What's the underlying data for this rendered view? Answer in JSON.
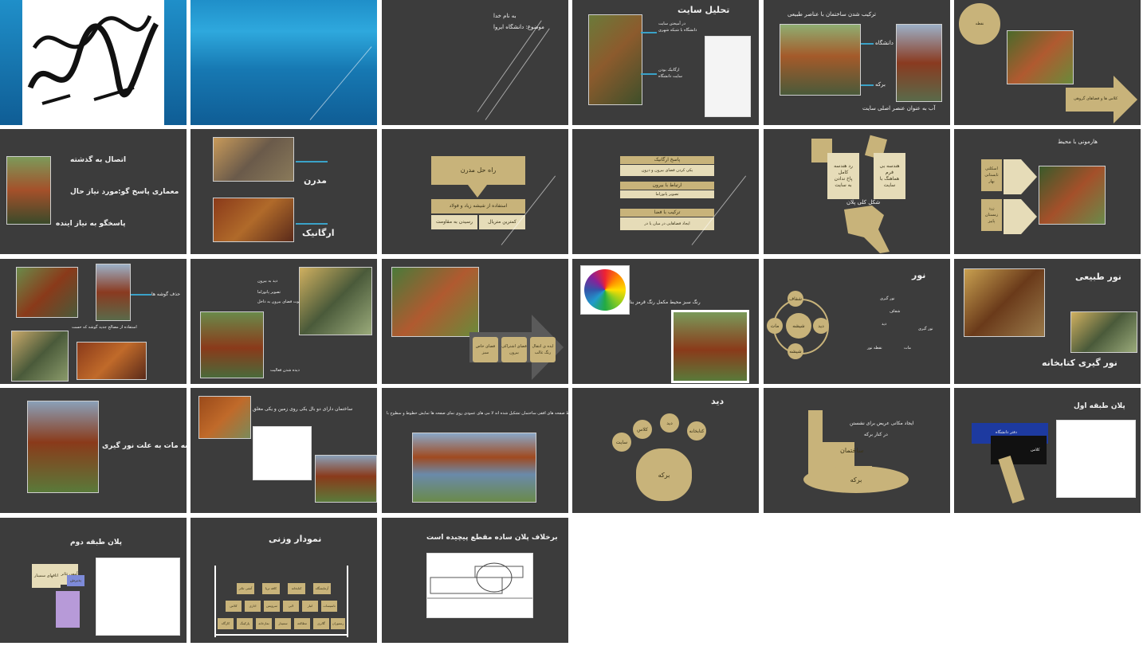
{
  "slides": {
    "s1": {
      "calligraphy": "بسم الله الرحمن الرحیم"
    },
    "s3": {
      "l1": "به نام خدا",
      "l2": "موضوع: دانشگاه ایروا"
    },
    "s4": {
      "title": "تحلیل سایت",
      "a": "در آمیختن سایت",
      "b": "دانشگاه با شبکه شهری",
      "c": "ارگانیک بودن",
      "d": "سایت دانشگاه"
    },
    "s5": {
      "title": "ترکیب شدن ساختمان با عناصر طبیعی",
      "a": "دانشگاه",
      "b": "برکه",
      "c": "آب به عنوان عنصر اصلی سایت"
    },
    "s6": {
      "pie1": "نقطه",
      "pie2": "محیط",
      "arrow": "کلاس ها و فضاهای گروهی"
    },
    "s7": {
      "a": "اتصال به گذشته",
      "b": "معماری پاسخ گو:",
      "c": "مورد نیاز حال",
      "d": "پاسخگو به نیاز اینده"
    },
    "s8": {
      "a": "مدرن",
      "b": "ارگانیک"
    },
    "s9": {
      "top": "راه حل مدرن",
      "mid": "استفاده از شیشه زیاد و فولاد",
      "l": "رسیدن به مقاومت",
      "r": "کمترین متریال"
    },
    "s10": {
      "h1": "پاسخ ارگانیک",
      "d1": "یکی کردن فضای بیرون و درون",
      "d1b": "جهت نشان لحظه ترکیب درون و خارج",
      "h2": "ارتباط با بیرون",
      "d2": "تصویر پانوراما",
      "h3": "ترکیب با فضا",
      "d3": "ایجاد فضاهایی در میان یا در",
      "d3b": "تطابق برای دیده شدن محیطا با یا",
      "d3c": "محیط"
    },
    "s11": {
      "a": "رد هندسه",
      "b": "کامل",
      "c": "پاخ ندادن",
      "d": "به سایت",
      "e": "هندسه بی",
      "f": "فرم",
      "g": "هماهنگ با",
      "h": "سایت",
      "cap": "شکل کلی پلان"
    },
    "s12": {
      "title": "هارمونی با محیط",
      "l1": "اسکلتی",
      "l2": "تابستانی",
      "l3": "بهار",
      "r1": "زرد",
      "r2": "زمستان",
      "r3": "پاییز",
      "x1": "قرمز",
      "x2": "نارنجی",
      "x3": "سبز",
      "x4": "سبز",
      "x5": "قهوه ای",
      "x6": "سفید"
    },
    "s13": {
      "a": "حذف گوشه ها",
      "b": "استفاده از مصالح جدید گوشه که حست"
    },
    "s14": {
      "a": "دید به بیرون",
      "b": "تصویر پانوراما",
      "c": "دعوت فضای بیرون به داخل",
      "d": "دیده شدن فعالیت"
    },
    "s15": {
      "b1": "فضای خاص سبز",
      "b2": "فضای اشتراکی بیرون",
      "b3": "ایده ی انتقال رنگ غالب"
    },
    "s16": {
      "cap": "رنگ سبز محیط مکمل رنگ قرمز بنا"
    },
    "s17": {
      "title": "نور",
      "c1": "شفاف",
      "c2": "دید",
      "c3": "شیشه",
      "c4": "مات",
      "center": "شیشه",
      "r1": "نور گیری",
      "r2": "شفاف",
      "r3": "دید",
      "r4": "نور گیری",
      "r5": "مات",
      "r6": "نقطه نور"
    },
    "s18": {
      "a": "نور طبیعی",
      "b": "نور گیری کتابخانه"
    },
    "s19": {
      "a": "شیشه مات به علت نور گیری"
    },
    "s20": {
      "a": "ساختمان دارای دو بال یکی روی زمین و یکی معلق"
    },
    "s21": {
      "a": "شیت ها توسط صفحه های افقی ساختمان تشکیل شده اند لا می های عمودی روی نمای صفحه ها تمایش خطوط و سطوح با"
    },
    "s22": {
      "title": "دید",
      "b1": "سایت",
      "b2": "کلاس",
      "b3": "دید",
      "b4": "کتابخانه",
      "main": "برکه"
    },
    "s23": {
      "a": "ایجاد مکانی عریض برای نشستن",
      "b": "در کنار برکه",
      "c": "ساختمان",
      "d": "برکه"
    },
    "s24": {
      "title": "پلان طبقه اول",
      "a": "دفتر دانشگاه",
      "b": "کلاس"
    },
    "s25": {
      "title": "پلان طبقه دوم",
      "a": "اتاقهای سمینار",
      "b": "آمفی تئاتر",
      "c": "پذیرش"
    },
    "s26": {
      "title": "نمودار وزنی",
      "boxes": [
        "آمفی تئاتر",
        "کافه تریا",
        "کتابخانه",
        "آزمایشگاه",
        "کلاس",
        "اداری",
        "سرویس",
        "لابی",
        "انبار",
        "تاسیسات",
        "کارگاه",
        "پارکینگ",
        "نمازخانه",
        "سمینار",
        "مطالعه",
        "گالری",
        "رستوران",
        "پرسنل",
        "آشپزخانه",
        "پذیرش",
        "بایگانی"
      ]
    },
    "s27": {
      "title": "برخلاف پلان ساده مقطع پیچیده است"
    }
  },
  "colors": {
    "slide_bg": "#3c3c3c",
    "accent_box": "#c8b37a",
    "arrow_blue": "#3aa2c8",
    "blue_slide": "#1f8fc9"
  }
}
